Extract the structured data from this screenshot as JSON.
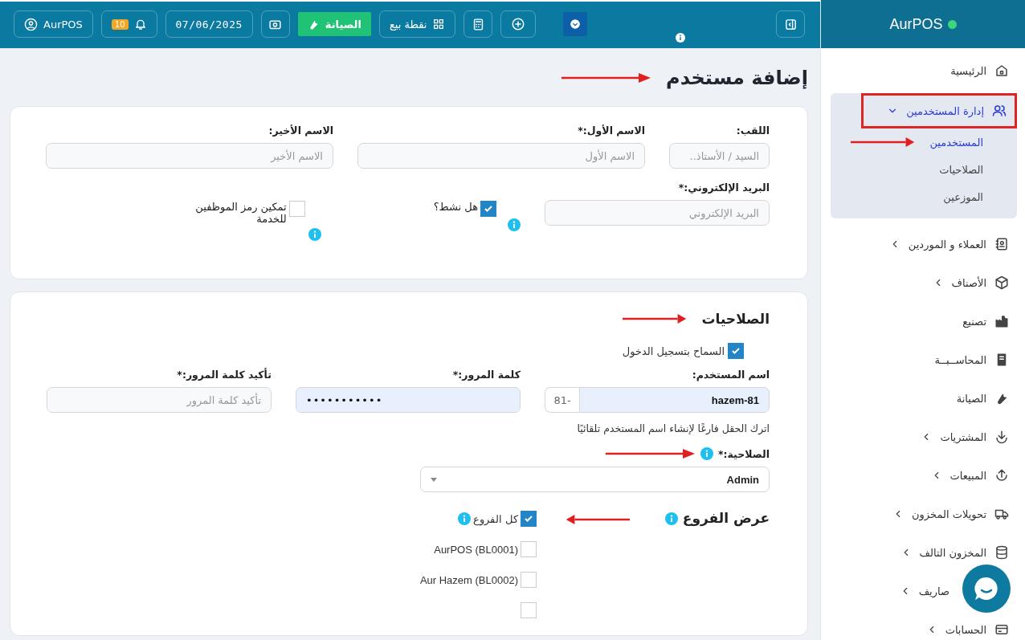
{
  "topbar": {
    "user_button": "AurPOS",
    "notification_count": "10",
    "date": "07/06/2025",
    "maintenance_button": "الصيانة",
    "pos_button": "نقطة بيع"
  },
  "sidebar": {
    "brand": "AurPOS",
    "items": [
      {
        "kind": "link",
        "label": "الرئيسية"
      },
      {
        "kind": "group",
        "label": "إدارة المستخدمين",
        "expanded": true,
        "children": [
          {
            "label": "المستخدمين",
            "selected": true
          },
          {
            "label": "الصلاحيات",
            "selected": false
          },
          {
            "label": "الموزعين",
            "selected": false
          }
        ]
      },
      {
        "kind": "group",
        "label": "العملاء و الموردين",
        "expanded": false
      },
      {
        "kind": "group",
        "label": "الأصناف",
        "expanded": false
      },
      {
        "kind": "link",
        "label": "تصنيع"
      },
      {
        "kind": "link",
        "label": "المحاســبــة"
      },
      {
        "kind": "link",
        "label": "الصيانة"
      },
      {
        "kind": "group",
        "label": "المشتريات",
        "expanded": false
      },
      {
        "kind": "group",
        "label": "المبيعات",
        "expanded": false
      },
      {
        "kind": "group",
        "label": "تحويلات المخزون",
        "expanded": false
      },
      {
        "kind": "group",
        "label": "المخزون التالف",
        "expanded": false
      },
      {
        "kind": "covered",
        "label": "صاريف",
        "expanded": false
      },
      {
        "kind": "group",
        "label": "الحسابات",
        "expanded": false
      }
    ]
  },
  "page": {
    "title": "إضافة مستخدم"
  },
  "profile": {
    "fields": [
      {
        "label": "اللقب:",
        "placeholder": "السيد / الأستاذ.."
      },
      {
        "label": "الاسم الأول:*",
        "placeholder": "الاسم الأول"
      },
      {
        "label": "الاسم الأخير:",
        "placeholder": "الاسم الأخير"
      }
    ],
    "email": {
      "label": "البريد الإلكتروني:*",
      "placeholder": "البريد الإلكتروني"
    },
    "options": [
      {
        "label": "هل نشط؟",
        "checked": true
      },
      {
        "label": "تمكين رمز الموظفين للخدمة",
        "checked": false
      }
    ]
  },
  "permissions": {
    "title": "الصلاحيات",
    "allow_login": {
      "label": "السماح بتسجيل الدخول",
      "checked": true
    },
    "username": {
      "label": "اسم المستخدم:",
      "value": "hazem-81",
      "suffix": "-81"
    },
    "password": {
      "label": "كلمة المرور:*",
      "value": "•••••••••••"
    },
    "confirm_password": {
      "label": "تأكيد كلمة المرور:*",
      "placeholder": "تأكيد كلمة المرور"
    },
    "hint": "اترك الحقل فارغًا لإنشاء اسم المستخدم تلقائيًا",
    "role": {
      "label": "الصلاحية:*",
      "value": "Admin"
    },
    "branches": {
      "title": "عرض الفروع",
      "all": {
        "label": "كل الفروع",
        "checked": true
      },
      "items": [
        {
          "label": "AurPOS (BL0001)",
          "checked": false
        },
        {
          "label": "Aur Hazem (BL0002)",
          "checked": false
        },
        {
          "checked": false
        }
      ]
    }
  }
}
